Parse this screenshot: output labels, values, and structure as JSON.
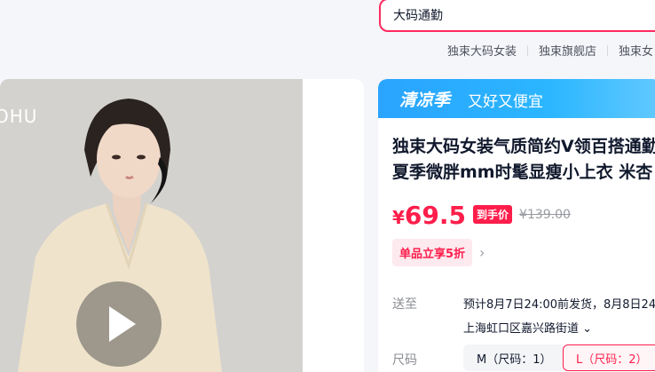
{
  "search": {
    "value": "大码通勤"
  },
  "hot_links": [
    "独束大码女装",
    "独束旗舰店",
    "独束女"
  ],
  "gallery": {
    "brand_text": "OHU",
    "has_video": true
  },
  "promo": {
    "title": "清凉季",
    "subtitle": "又好又便宜"
  },
  "product": {
    "title_line1": "独束大码女装气质简约V领百搭通勤",
    "title_line2": "夏季微胖mm时髦显瘦小上衣 米杏"
  },
  "price": {
    "symbol": "¥",
    "value": "69.5",
    "tag": "到手价",
    "original": "¥139.00"
  },
  "discount": {
    "label": "单品立享5折",
    "chevron": "›"
  },
  "shipping": {
    "label": "送至",
    "info": "预计8月7日24:00前发货，8月8日24",
    "location": "上海虹口区嘉兴路街道 ⌄"
  },
  "size": {
    "label": "尺码",
    "options": [
      "M（尺码：1）",
      "L（尺码：2）"
    ],
    "selected": "L（尺码：2）"
  },
  "colors": {
    "accent": "#ff1e4b",
    "promo": "#2aa4ff"
  },
  "icons": {
    "play": "play-icon",
    "chevron_right": "chevron-right-icon",
    "chevron_down": "chevron-down-icon"
  }
}
